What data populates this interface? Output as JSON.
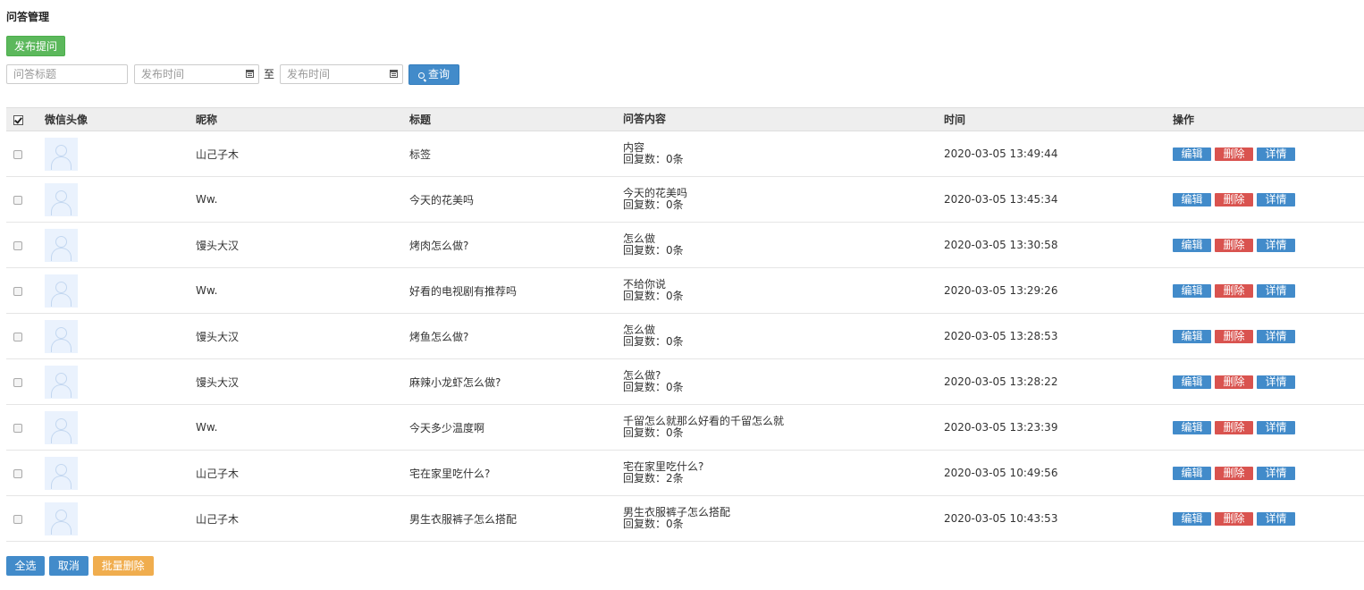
{
  "page": {
    "title": "问答管理"
  },
  "toolbar": {
    "publish_label": "发布提问"
  },
  "filter": {
    "title_placeholder": "问答标题",
    "start_placeholder": "发布时间",
    "end_placeholder": "发布时间",
    "to_label": "至",
    "query_label": "查询"
  },
  "table": {
    "headers": {
      "avatar": "微信头像",
      "nickname": "昵称",
      "title": "标题",
      "content": "问答内容",
      "time": "时间",
      "actions": "操作"
    },
    "actions": {
      "edit": "编辑",
      "delete": "删除",
      "detail": "详情"
    },
    "rows": [
      {
        "nickname": "山己子木",
        "title": "标签",
        "content": "内容",
        "replies": "回复数：0条",
        "time": "2020-03-05 13:49:44"
      },
      {
        "nickname": "Ww.",
        "title": "今天的花美吗",
        "content": "今天的花美吗",
        "replies": "回复数：0条",
        "time": "2020-03-05 13:45:34"
      },
      {
        "nickname": "馒头大汉",
        "title": "烤肉怎么做?",
        "content": "怎么做",
        "replies": "回复数：0条",
        "time": "2020-03-05 13:30:58"
      },
      {
        "nickname": "Ww.",
        "title": "好看的电视剧有推荐吗",
        "content": "不给你说",
        "replies": "回复数：0条",
        "time": "2020-03-05 13:29:26"
      },
      {
        "nickname": "馒头大汉",
        "title": "烤鱼怎么做?",
        "content": "怎么做",
        "replies": "回复数：0条",
        "time": "2020-03-05 13:28:53"
      },
      {
        "nickname": "馒头大汉",
        "title": "麻辣小龙虾怎么做?",
        "content": "怎么做?",
        "replies": "回复数：0条",
        "time": "2020-03-05 13:28:22"
      },
      {
        "nickname": "Ww.",
        "title": "今天多少温度啊",
        "content": "千留怎么就那么好看的千留怎么就",
        "replies": "回复数：0条",
        "time": "2020-03-05 13:23:39"
      },
      {
        "nickname": "山己子木",
        "title": "宅在家里吃什么?",
        "content": "宅在家里吃什么?",
        "replies": "回复数：2条",
        "time": "2020-03-05 10:49:56"
      },
      {
        "nickname": "山己子木",
        "title": "男生衣服裤子怎么搭配",
        "content": "男生衣服裤子怎么搭配",
        "replies": "回复数：0条",
        "time": "2020-03-05 10:43:53"
      }
    ]
  },
  "bottom": {
    "select_all": "全选",
    "cancel": "取消",
    "batch_delete": "批量删除"
  },
  "colors": {
    "primary": "#428bca",
    "success": "#5cb85c",
    "danger": "#d9534f",
    "warning": "#f0ad4e"
  },
  "icons": {
    "calendar": "calendar-icon",
    "search": "search-icon",
    "avatar": "user-avatar-icon",
    "check": "check-icon"
  }
}
